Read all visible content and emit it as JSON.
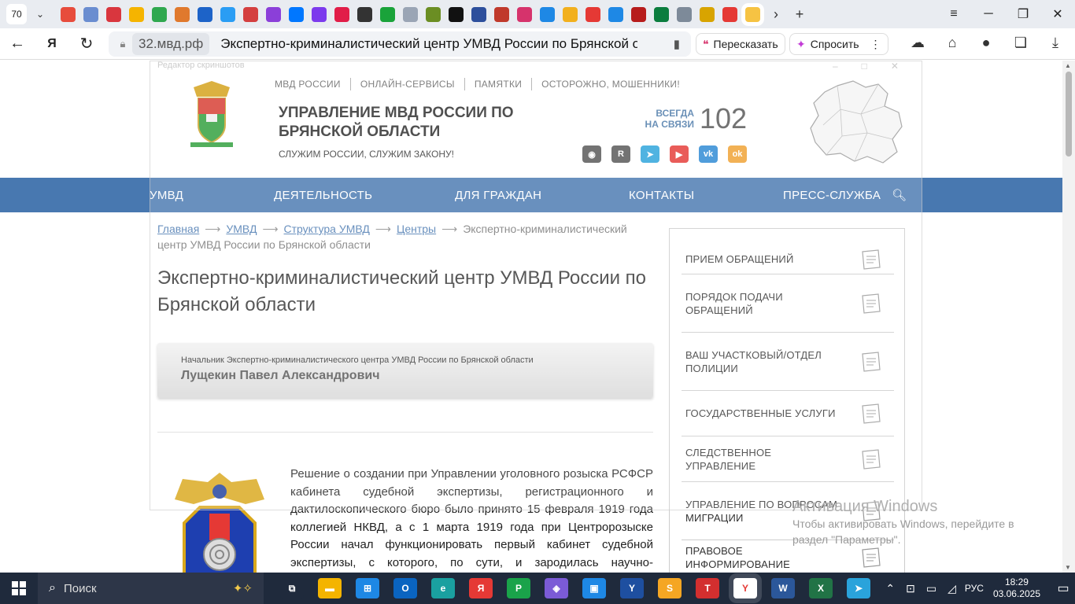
{
  "browser": {
    "tab_count": "70",
    "url_domain": "32.мвд.рф",
    "page_title": "Экспертно-криминалистический центр УМВД России по Брянской о...",
    "retell_label": "Пересказать",
    "ask_label": "Спросить",
    "tab_favicons": [
      "#e74c3c",
      "#6a8dd0",
      "#d9363e",
      "#f5b400",
      "#2fa84f",
      "#e0792d",
      "#1d63c8",
      "#2a9df4",
      "#d43f3f",
      "#8b3fd9",
      "#0077ff",
      "#7c3aed",
      "#e11d48",
      "#333333",
      "#1aa33a",
      "#9aa5b5",
      "#6b8e23",
      "#111111",
      "#2d4f9c",
      "#c0392b",
      "#d6336c",
      "#1e88e5",
      "#f2b01e",
      "#e53935",
      "#1e88e5",
      "#b71c1c",
      "#0b7d3e",
      "#7d8a99",
      "#d8a400",
      "#e53935",
      "#f6c343"
    ]
  },
  "header": {
    "top_links": [
      "МВД РОССИИ",
      "ОНЛАЙН-СЕРВИСЫ",
      "ПАМЯТКИ",
      "ОСТОРОЖНО, МОШЕННИКИ!"
    ],
    "org_name": "УПРАВЛЕНИЕ МВД РОССИИ ПО БРЯНСКОЙ ОБЛАСТИ",
    "motto": "СЛУЖИМ РОССИИ, СЛУЖИМ ЗАКОНУ!",
    "always_line1": "ВСЕГДА",
    "always_line2": "НА СВЯЗИ",
    "phone": "102",
    "socials": [
      {
        "name": "eye-icon",
        "color": "#555555",
        "glyph": "◉"
      },
      {
        "name": "rutube-icon",
        "color": "#555555",
        "glyph": "R"
      },
      {
        "name": "telegram-icon",
        "color": "#2aa3db",
        "glyph": "➤"
      },
      {
        "name": "youtube-icon",
        "color": "#e53935",
        "glyph": "▶"
      },
      {
        "name": "vk-icon",
        "color": "#2a88d4",
        "glyph": "vk"
      },
      {
        "name": "ok-icon",
        "color": "#f0a030",
        "glyph": "ok"
      }
    ]
  },
  "overlay": {
    "title": "Редактор скриншотов"
  },
  "main_nav": [
    "УМВД",
    "ДЕЯТЕЛЬНОСТЬ",
    "ДЛЯ ГРАЖДАН",
    "КОНТАКТЫ",
    "ПРЕСС-СЛУЖБА"
  ],
  "breadcrumb": {
    "items": [
      "Главная",
      "УМВД",
      "Структура УМВД",
      "Центры"
    ],
    "current": "Экспертно-криминалистический центр УМВД России по Брянской области"
  },
  "page_heading": "Экспертно-криминалистический центр УМВД России по Брянской области",
  "chief": {
    "position": "Начальник Экспертно-криминалистического центра УМВД России по Брянской области",
    "name": "Лущекин Павел Александрович"
  },
  "body_text": "Решение о создании при Управлении уголовного розыска РСФСР кабинета судебной экспертизы, регистрационного и дактилоскопического бюро было принято 15 февраля 1919 года коллегией НКВД, а с 1 марта 1919 года при Центророзыске России начал функционировать первый кабинет судебной экспертизы, с которого, по сути, и зародилась научно-техническая",
  "sidebar": [
    {
      "label": "ПРИЕМ ОБРАЩЕНИЙ",
      "icon": "document-icon"
    },
    {
      "label": "ПОРЯДОК ПОДАЧИ ОБРАЩЕНИЙ",
      "icon": "document-icon"
    },
    {
      "label": "ВАШ УЧАСТКОВЫЙ/ОТДЕЛ ПОЛИЦИИ",
      "icon": "police-cap-icon"
    },
    {
      "label": "ГОСУДАРСТВЕННЫЕ УСЛУГИ",
      "icon": "gosuslugi-icon"
    },
    {
      "label": "СЛЕДСТВЕННОЕ УПРАВЛЕНИЕ",
      "icon": "document-pen-icon"
    },
    {
      "label": "УПРАВЛЕНИЕ ПО ВОПРОСАМ МИГРАЦИИ",
      "icon": "passport-icon"
    },
    {
      "label": "ПРАВОВОЕ ИНФОРМИРОВАНИЕ",
      "icon": "printer-icon"
    }
  ],
  "activation": {
    "title": "Активация Windows",
    "text": "Чтобы активировать Windows, перейдите в раздел \"Параметры\"."
  },
  "taskbar": {
    "search_placeholder": "Поиск",
    "apps": [
      {
        "name": "task-view-icon",
        "color": "#1f2a3c",
        "glyph": "⧉"
      },
      {
        "name": "file-explorer-icon",
        "color": "#f4b400",
        "glyph": "▬"
      },
      {
        "name": "store-icon",
        "color": "#1e88e5",
        "glyph": "⊞"
      },
      {
        "name": "outlook-icon",
        "color": "#0a64c0",
        "glyph": "O"
      },
      {
        "name": "edge-icon",
        "color": "#1aa0a0",
        "glyph": "e"
      },
      {
        "name": "yandex-icon",
        "color": "#e53935",
        "glyph": "Я"
      },
      {
        "name": "sheets-icon",
        "color": "#1aa34a",
        "glyph": "P"
      },
      {
        "name": "gamepad-icon",
        "color": "#7b5bd6",
        "glyph": "◈"
      },
      {
        "name": "remote-icon",
        "color": "#1e88e5",
        "glyph": "▣"
      },
      {
        "name": "y-app-icon",
        "color": "#1e4fa0",
        "glyph": "Y"
      },
      {
        "name": "s-app-icon",
        "color": "#f5a623",
        "glyph": "S"
      },
      {
        "name": "presentation-icon",
        "color": "#d32f2f",
        "glyph": "T"
      },
      {
        "name": "yandex-browser-icon",
        "color": "#ffffff",
        "glyph": "Y"
      },
      {
        "name": "word-icon",
        "color": "#2b579a",
        "glyph": "W"
      },
      {
        "name": "excel-icon",
        "color": "#217346",
        "glyph": "X"
      },
      {
        "name": "telegram-icon",
        "color": "#2aa3db",
        "glyph": "➤"
      }
    ],
    "language": "РУС",
    "time": "18:29",
    "date": "03.06.2025"
  }
}
